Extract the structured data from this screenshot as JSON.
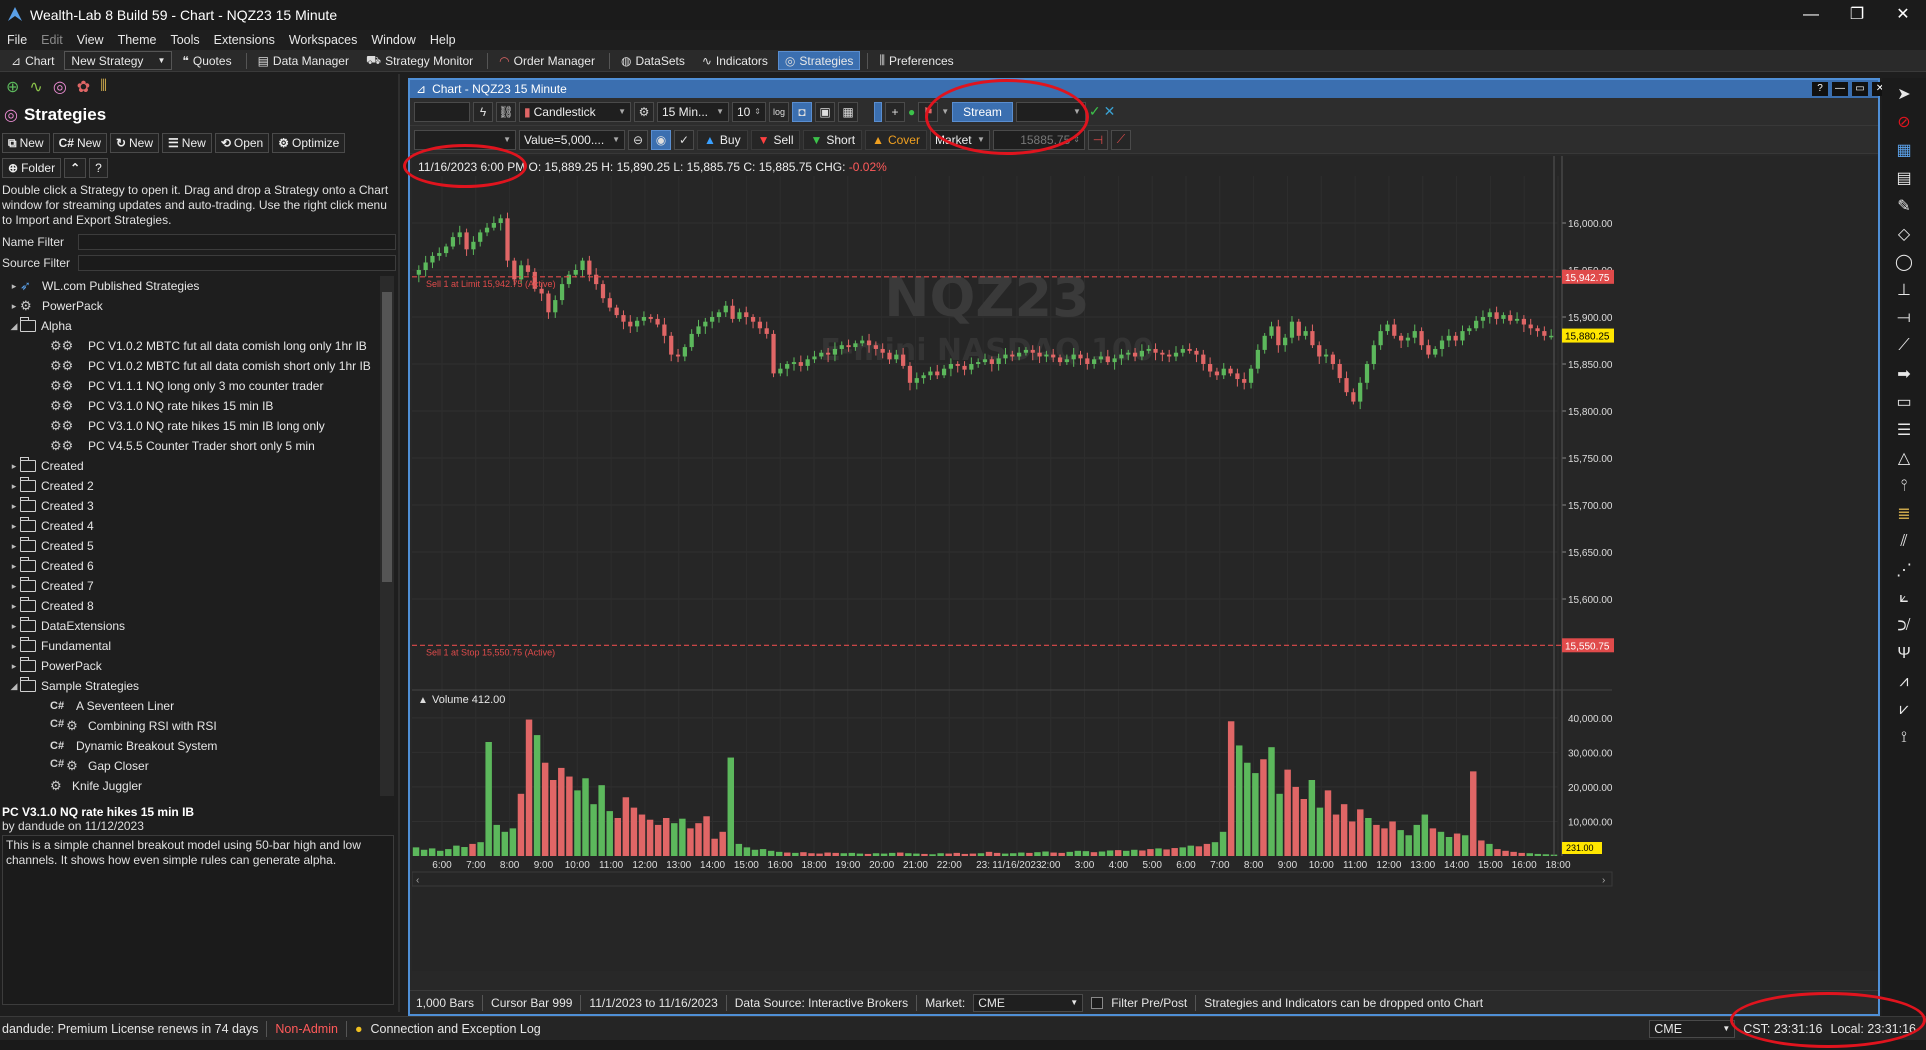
{
  "window": {
    "title": "Wealth-Lab 8 Build 59 - Chart - NQZ23 15 Minute",
    "minimize": "—",
    "maximize": "❐",
    "close": "✕"
  },
  "menu": [
    "File",
    "Edit",
    "View",
    "Theme",
    "Tools",
    "Extensions",
    "Workspaces",
    "Window",
    "Help"
  ],
  "toolbar": {
    "chart": "Chart",
    "new_strategy": "New Strategy",
    "quotes": "Quotes",
    "data_manager": "Data Manager",
    "strategy_monitor": "Strategy Monitor",
    "order_manager": "Order Manager",
    "datasets": "DataSets",
    "indicators": "Indicators",
    "strategies": "Strategies",
    "preferences": "Preferences"
  },
  "left": {
    "title": "Strategies",
    "buttons": {
      "new1": "New",
      "new2": "New",
      "new3": "New",
      "new4": "New",
      "open": "Open",
      "optimize": "Optimize",
      "folder": "Folder",
      "help": "?"
    },
    "help_text": "Double click a Strategy to open it. Drag and drop a Strategy onto a Chart window for streaming updates and auto-trading. Use the right click menu to Import and Export Strategies.",
    "name_filter": "Name Filter",
    "source_filter": "Source Filter",
    "tree": [
      {
        "label": "WL.com Published Strategies",
        "kind": "root-wl",
        "level": 0,
        "expand": "▸"
      },
      {
        "label": "PowerPack",
        "kind": "root-gear",
        "level": 0,
        "expand": "▸"
      },
      {
        "label": "Alpha",
        "kind": "folder",
        "level": 0,
        "expand": "◢"
      },
      {
        "label": "PC V1.0.2 MBTC fut all data comish long only 1hr IB",
        "kind": "gear2",
        "level": 1,
        "expand": ""
      },
      {
        "label": "PC V1.0.2 MBTC fut all data comish short only 1hr IB",
        "kind": "gear2",
        "level": 1,
        "expand": ""
      },
      {
        "label": "PC V1.1.1 NQ long only 3 mo counter trader",
        "kind": "gear2",
        "level": 1,
        "expand": ""
      },
      {
        "label": "PC V3.1.0 NQ rate hikes 15 min IB",
        "kind": "gear2",
        "level": 1,
        "expand": ""
      },
      {
        "label": "PC V3.1.0 NQ rate hikes 15 min IB long only",
        "kind": "gear2",
        "level": 1,
        "expand": ""
      },
      {
        "label": "PC V4.5.5 Counter Trader short only 5 min",
        "kind": "gear2",
        "level": 1,
        "expand": ""
      },
      {
        "label": "Created",
        "kind": "folder",
        "level": 0,
        "expand": "▸"
      },
      {
        "label": "Created 2",
        "kind": "folder",
        "level": 0,
        "expand": "▸"
      },
      {
        "label": "Created 3",
        "kind": "folder",
        "level": 0,
        "expand": "▸"
      },
      {
        "label": "Created 4",
        "kind": "folder",
        "level": 0,
        "expand": "▸"
      },
      {
        "label": "Created 5",
        "kind": "folder",
        "level": 0,
        "expand": "▸"
      },
      {
        "label": "Created 6",
        "kind": "folder",
        "level": 0,
        "expand": "▸"
      },
      {
        "label": "Created 7",
        "kind": "folder",
        "level": 0,
        "expand": "▸"
      },
      {
        "label": "Created 8",
        "kind": "folder",
        "level": 0,
        "expand": "▸"
      },
      {
        "label": "DataExtensions",
        "kind": "folder",
        "level": 0,
        "expand": "▸"
      },
      {
        "label": "Fundamental",
        "kind": "folder",
        "level": 0,
        "expand": "▸"
      },
      {
        "label": "PowerPack",
        "kind": "folder",
        "level": 0,
        "expand": "▸"
      },
      {
        "label": "Sample Strategies",
        "kind": "folder",
        "level": 0,
        "expand": "◢"
      },
      {
        "label": "A Seventeen Liner",
        "kind": "cs",
        "level": 1,
        "expand": ""
      },
      {
        "label": "Combining RSI with RSI",
        "kind": "cs-gear",
        "level": 1,
        "expand": ""
      },
      {
        "label": "Dynamic Breakout System",
        "kind": "cs",
        "level": 1,
        "expand": ""
      },
      {
        "label": "Gap Closer",
        "kind": "cs-gear",
        "level": 1,
        "expand": ""
      },
      {
        "label": "Knife Juggler",
        "kind": "gear",
        "level": 1,
        "expand": ""
      }
    ],
    "desc_title": "PC V3.1.0 NQ rate hikes 15 min IB",
    "desc_by": "by dandude on 11/12/2023",
    "desc_text": "This is a simple channel breakout model using 50-bar high and low channels. It shows how even simple rules can generate alpha."
  },
  "chart": {
    "window_title": "Chart - NQZ23 15 Minute",
    "help": "?",
    "chart_style": "Candlestick",
    "scale": "15 Min...",
    "bars_value": "10",
    "log": "log",
    "stream": "Stream",
    "position_size": "Value=5,000....",
    "buy": "Buy",
    "sell": "Sell",
    "short": "Short",
    "cover": "Cover",
    "order_type": "Market",
    "limit_price": "15885.75",
    "info_date": "11/16/2023 6:00 PM",
    "info_ohlc": "O: 15,889.25 H: 15,890.25 L: 15,885.75 C: 15,885.75 CHG:",
    "info_chg": "-0.02%",
    "watermark_symbol": "NQZ23",
    "watermark_name": "E-mini NASDAQ 100",
    "sell_limit_label": "Sell 1 at Limit 15,942.75 (Active)",
    "sell_stop_label": "Sell 1 at Stop 15,550.75 (Active)",
    "sell_limit_price": "15,942.75",
    "sell_stop_price": "15,550.75",
    "last_price": "15,880.25",
    "volume_label": "Volume 412.00",
    "volume_last": "231.00",
    "price_ticks": [
      "16,000.00",
      "15,950.00",
      "15,900.00",
      "15,850.00",
      "15,800.00",
      "15,750.00",
      "15,700.00",
      "15,650.00",
      "15,600.00"
    ],
    "volume_ticks": [
      "40,000.00",
      "30,000.00",
      "20,000.00",
      "10,000.00"
    ],
    "time_ticks": [
      "6:00",
      "7:00",
      "8:00",
      "9:00",
      "10:00",
      "11:00",
      "12:00",
      "13:00",
      "14:00",
      "15:00",
      "16:00",
      "18:00",
      "19:00",
      "20:00",
      "21:00",
      "22:00",
      "23:",
      "11/16/2023",
      "2:00",
      "3:00",
      "4:00",
      "5:00",
      "6:00",
      "7:00",
      "8:00",
      "9:00",
      "10:00",
      "11:00",
      "12:00",
      "13:00",
      "14:00",
      "15:00",
      "16:00",
      "18:00"
    ],
    "status": {
      "bars": "1,000 Bars",
      "cursor": "Cursor Bar 999",
      "range": "11/1/2023 to 11/16/2023",
      "datasource": "Data Source: Interactive Brokers",
      "market_label": "Market:",
      "market": "CME",
      "filter": "Filter Pre/Post",
      "hint": "Strategies and Indicators can be dropped onto Chart"
    },
    "colors": {
      "up": "#5cb85c",
      "down": "#e06666",
      "order_line": "#e04b4b",
      "last_price": "#ffe600"
    }
  },
  "chart_data": {
    "type": "candlestick",
    "title": "NQZ23 15 Minute",
    "ylim": [
      15550,
      16050
    ],
    "price_path": [
      15945,
      15950,
      15958,
      15965,
      15968,
      15975,
      15985,
      15990,
      15972,
      15980,
      15990,
      15995,
      16000,
      16005,
      15960,
      15940,
      15955,
      15948,
      15930,
      15925,
      15905,
      15918,
      15935,
      15945,
      15950,
      15960,
      15945,
      15935,
      15920,
      15910,
      15902,
      15895,
      15890,
      15896,
      15900,
      15898,
      15892,
      15880,
      15860,
      15858,
      15868,
      15882,
      15890,
      15895,
      15900,
      15905,
      15912,
      15898,
      15905,
      15900,
      15895,
      15888,
      15882,
      15840,
      15845,
      15850,
      15852,
      15848,
      15855,
      15858,
      15862,
      15860,
      15866,
      15870,
      15868,
      15872,
      15875,
      15870,
      15866,
      15862,
      15855,
      15860,
      15848,
      15830,
      15835,
      15838,
      15842,
      15838,
      15845,
      15850,
      15848,
      15844,
      15850,
      15852,
      15855,
      15850,
      15856,
      15860,
      15858,
      15862,
      15865,
      15862,
      15858,
      15860,
      15857,
      15852,
      15855,
      15860,
      15856,
      15850,
      15855,
      15858,
      15852,
      15856,
      15860,
      15862,
      15858,
      15864,
      15866,
      15862,
      15860,
      15858,
      15862,
      15866,
      15864,
      15860,
      15850,
      15842,
      15838,
      15845,
      15840,
      15834,
      15830,
      15845,
      15865,
      15880,
      15890,
      15870,
      15878,
      15895,
      15880,
      15885,
      15870,
      15858,
      15860,
      15850,
      15835,
      15820,
      15810,
      15830,
      15850,
      15870,
      15885,
      15892,
      15880,
      15875,
      15878,
      15885,
      15870,
      15860,
      15866,
      15875,
      15880,
      15875,
      15885,
      15888,
      15896,
      15900,
      15905,
      15898,
      15902,
      15896,
      15898,
      15892,
      15888,
      15885,
      15880,
      15880
    ],
    "volume_path": [
      2500,
      1800,
      2200,
      1500,
      2000,
      3000,
      2600,
      3500,
      4000,
      33000,
      9000,
      7000,
      8000,
      18000,
      39500,
      35000,
      27000,
      22000,
      25500,
      23000,
      19000,
      22500,
      15000,
      20500,
      13000,
      11000,
      17000,
      14000,
      12000,
      10500,
      9000,
      11000,
      9500,
      10800,
      8000,
      9500,
      11500,
      5000,
      7000,
      28500,
      3500,
      2500,
      1800,
      2000,
      1500,
      1200,
      1000,
      900,
      1100,
      800,
      700,
      1000,
      900,
      800,
      900,
      700,
      600,
      800,
      700,
      900,
      1000,
      800,
      700,
      600,
      500,
      800,
      700,
      900,
      600,
      700,
      800,
      1200,
      900,
      700,
      800,
      1000,
      900,
      1100,
      1300,
      1000,
      900,
      1200,
      1500,
      1400,
      1100,
      1300,
      1600,
      1700,
      1500,
      1800,
      1600,
      2000,
      2200,
      1900,
      2300,
      2500,
      3000,
      2800,
      3500,
      4000,
      7000,
      39000,
      32000,
      27000,
      24000,
      28000,
      31500,
      18000,
      25000,
      20000,
      16500,
      22000,
      14000,
      19000,
      12000,
      15000,
      10000,
      13500,
      11000,
      9000,
      8000,
      10000,
      7500,
      6000,
      9000,
      12000,
      8000,
      7000,
      5500,
      6500,
      6000,
      24500,
      4500,
      3500,
      2000,
      1500,
      1200,
      900,
      800,
      600,
      500,
      400
    ]
  },
  "statusbar": {
    "license": "dandude: Premium License renews in 74 days",
    "admin": "Non-Admin",
    "log": "Connection and Exception Log",
    "market": "CME",
    "cst": "CST: 23:31:16",
    "local": "Local: 23:31:16"
  }
}
